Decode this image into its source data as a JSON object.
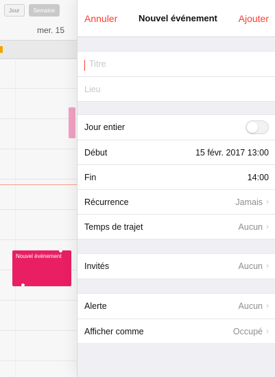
{
  "calendar": {
    "segment_left": "Jour",
    "segment_right": "Semaine",
    "date": "mer. 15",
    "new_event_text": "Nouvel\névénement"
  },
  "popover": {
    "header": {
      "cancel": "Annuler",
      "title": "Nouvel événement",
      "add": "Ajouter"
    },
    "fields": {
      "title_placeholder": "Titre",
      "location_placeholder": "Lieu"
    },
    "rows": {
      "all_day": "Jour entier",
      "start_label": "Début",
      "start_value": "15 févr. 2017   13:00",
      "end_label": "Fin",
      "end_value": "14:00",
      "recurrence_label": "Récurrence",
      "recurrence_value": "Jamais",
      "travel_label": "Temps de trajet",
      "travel_value": "Aucun",
      "invitees_label": "Invités",
      "invitees_value": "Aucun",
      "alert_label": "Alerte",
      "alert_value": "Aucun",
      "show_as_label": "Afficher comme",
      "show_as_value": "Occupé"
    }
  },
  "icons": {
    "chevron": "chevron-right-icon"
  }
}
